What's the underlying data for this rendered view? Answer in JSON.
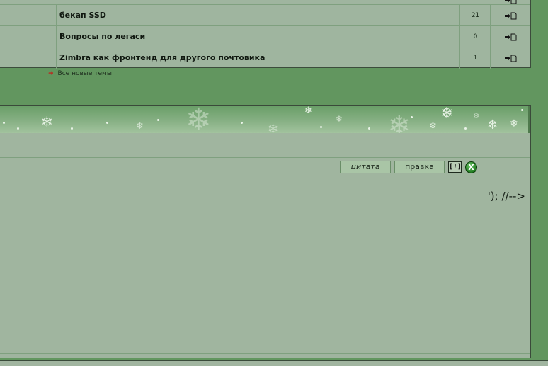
{
  "topics": [
    {
      "title": "бекап SSD",
      "count": "21"
    },
    {
      "title": "Вопросы по легаси",
      "count": "0"
    },
    {
      "title": "Zimbra как фронтенд для другого почтовика",
      "count": "1"
    }
  ],
  "new_topics_link": "Все новые темы",
  "post": {
    "quote_button": "цитата",
    "edit_button": "правка",
    "report_button": "[!]",
    "delete_button": "X",
    "body_text": "'); //-->"
  },
  "icons": {
    "goto": "goto-last-post-icon",
    "arrow": "red-arrow-icon",
    "delete": "green-x-icon",
    "banner": "snowflake-icon"
  },
  "colors": {
    "page_bg": "#62965f",
    "panel_bg": "#a0b59f",
    "border": "#3a4a3a",
    "accent_red": "#d01010"
  }
}
